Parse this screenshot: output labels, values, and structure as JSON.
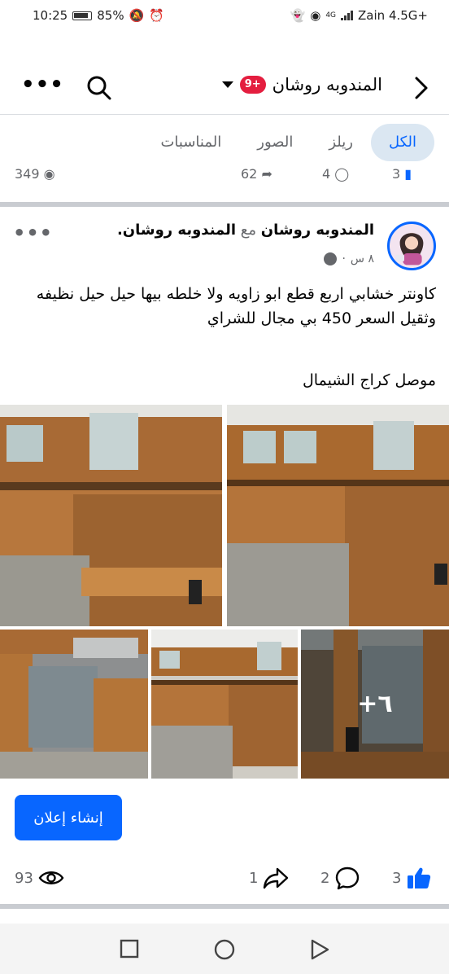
{
  "status_bar": {
    "time": "10:25",
    "battery": "85%",
    "carrier": "Zain 4.5G+",
    "network": "4G"
  },
  "header": {
    "title": "المندوبه روشان",
    "badge": "9+",
    "icons": {
      "back": "chevron-right-icon",
      "search": "search-icon",
      "more": "more-horizontal-icon",
      "dropdown": "caret-down-icon"
    }
  },
  "tabs": [
    {
      "label": "الكل",
      "active": true
    },
    {
      "label": "ريلز",
      "active": false
    },
    {
      "label": "الصور",
      "active": false
    },
    {
      "label": "المناسبات",
      "active": false
    }
  ],
  "prev_post": {
    "views": "349",
    "shares": "62",
    "comments": "4",
    "likes": "3"
  },
  "post": {
    "author": "المندوبه روشان",
    "with_word": "مع",
    "tagged": "المندوبه روشان.",
    "time": "٨ س",
    "dot": "·",
    "text": "كاونتر خشابي اربع قطع ابو زاويه  ولا خلطه بيها حيل حيل نظيفه وثقيل السعر 450 بي مجال للشراي",
    "location_line": "موصل  كراج الشيمال",
    "more_photos": "+٦",
    "boost_label": "إنشاء إعلان",
    "stats": {
      "views": "93",
      "shares": "1",
      "comments": "2",
      "likes": "3"
    }
  },
  "colors": {
    "accent": "#0866ff",
    "badge": "#e41e3f",
    "tab_active_bg": "#dbe7f2",
    "secondary_text": "#65676b"
  }
}
